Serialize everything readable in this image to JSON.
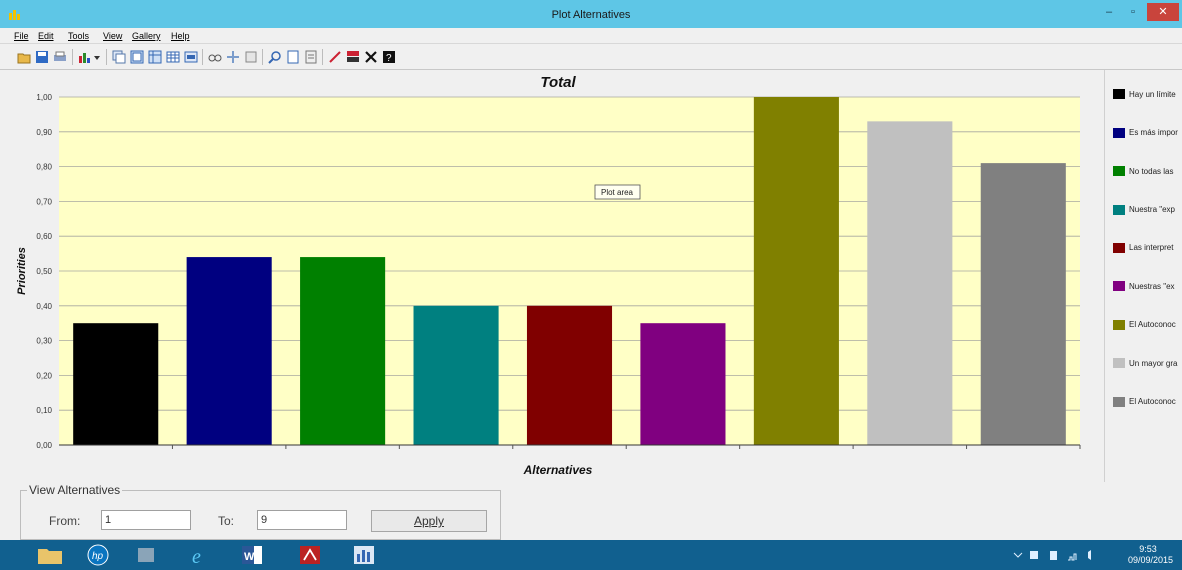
{
  "window": {
    "title": "Plot Alternatives",
    "controls": {
      "minimize": "–",
      "maximize": "▫",
      "close": "✕"
    }
  },
  "menu": [
    {
      "label": "File"
    },
    {
      "label": "Edit"
    },
    {
      "label": "Tools"
    },
    {
      "label": "View"
    },
    {
      "label": "Gallery"
    },
    {
      "label": "Help"
    }
  ],
  "toolbar": [
    "open-icon",
    "save-icon",
    "print-icon",
    "chart-type-icon",
    "dropdown-arrow-icon",
    "copy-icon",
    "view1-icon",
    "view2-icon",
    "data-grid-icon",
    "series-icon",
    "link-icon",
    "move-icon",
    "properties-icon",
    "zoom-icon",
    "page-icon",
    "page-setup-icon",
    "line-tool-icon",
    "palette-icon",
    "close-x-icon",
    "help-icon"
  ],
  "chart_data": {
    "type": "bar",
    "title": "Total",
    "xlabel": "Alternatives",
    "ylabel": "Priorities",
    "ylim": [
      0,
      1
    ],
    "yticks": [
      "0,00",
      "0,10",
      "0,20",
      "0,30",
      "0,40",
      "0,50",
      "0,60",
      "0,70",
      "0,80",
      "0,90",
      "1,00"
    ],
    "plot_area_label": "Plot area",
    "plot_background": "#ffffc6",
    "grid": true,
    "legend_position": "right",
    "series": [
      {
        "name": "Hay un límite",
        "value": 0.35,
        "color": "#000000"
      },
      {
        "name": "Es más impor",
        "value": 0.54,
        "color": "#000080"
      },
      {
        "name": "No todas las",
        "value": 0.54,
        "color": "#008000"
      },
      {
        "name": "Nuestra \"exp",
        "value": 0.4,
        "color": "#008080"
      },
      {
        "name": "Las interpret",
        "value": 0.4,
        "color": "#800000"
      },
      {
        "name": "Nuestras \"ex",
        "value": 0.35,
        "color": "#800080"
      },
      {
        "name": "El Autoconoc",
        "value": 1.0,
        "color": "#808000"
      },
      {
        "name": "Un mayor gra",
        "value": 0.93,
        "color": "#c0c0c0"
      },
      {
        "name": "El Autoconoc",
        "value": 0.81,
        "color": "#808080"
      }
    ]
  },
  "view_alternatives": {
    "title": "View Alternatives",
    "from_label": "From:",
    "from_value": "1",
    "to_label": "To:",
    "to_value": "9",
    "apply_label": "Apply"
  },
  "taskbar": {
    "apps": [
      "file-explorer-icon",
      "hp-icon",
      "app-icon",
      "internet-explorer-icon",
      "word-icon",
      "acrobat-icon",
      "app-plot-icon"
    ],
    "clock_time": "9:53",
    "clock_date": "09/09/2015"
  }
}
